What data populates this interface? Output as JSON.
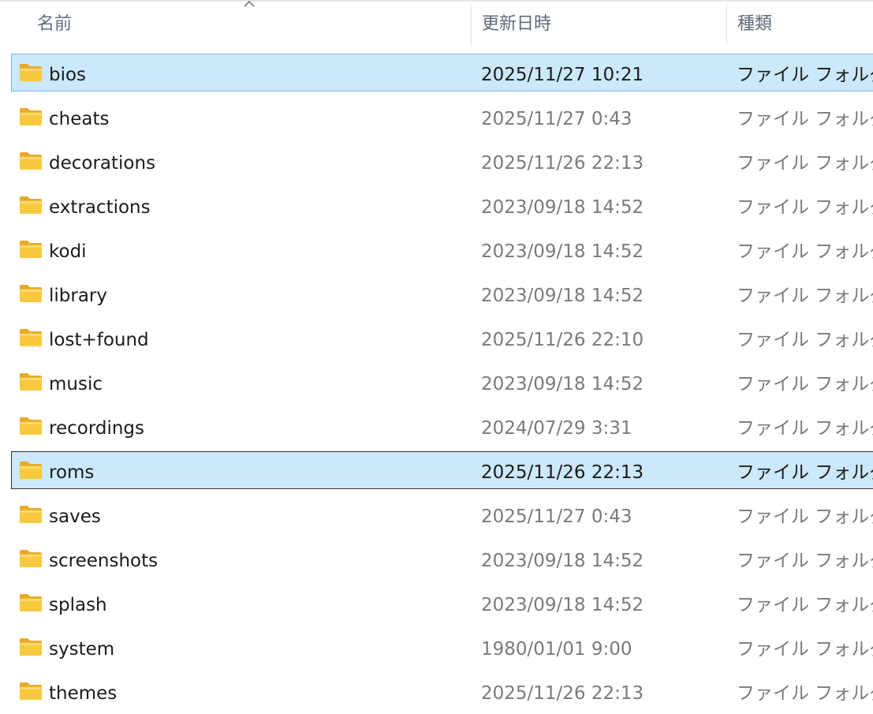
{
  "header": {
    "name_label": "名前",
    "date_label": "更新日時",
    "type_label": "種類",
    "sort_icon": "chevron-up-icon"
  },
  "colors": {
    "selection_bg": "#cce8fb",
    "selection_border": "#7ab4dc",
    "focus_border": "#2f2f2f",
    "folder_yellow": "#f8c93f"
  },
  "rows": [
    {
      "name": "bios",
      "date": "2025/11/27 10:21",
      "type": "ファイル フォルダー",
      "selected": true
    },
    {
      "name": "cheats",
      "date": "2025/11/27 0:43",
      "type": "ファイル フォルダー",
      "selected": false
    },
    {
      "name": "decorations",
      "date": "2025/11/26 22:13",
      "type": "ファイル フォルダー",
      "selected": false
    },
    {
      "name": "extractions",
      "date": "2023/09/18 14:52",
      "type": "ファイル フォルダー",
      "selected": false
    },
    {
      "name": "kodi",
      "date": "2023/09/18 14:52",
      "type": "ファイル フォルダー",
      "selected": false
    },
    {
      "name": "library",
      "date": "2023/09/18 14:52",
      "type": "ファイル フォルダー",
      "selected": false
    },
    {
      "name": "lost+found",
      "date": "2025/11/26 22:10",
      "type": "ファイル フォルダー",
      "selected": false
    },
    {
      "name": "music",
      "date": "2023/09/18 14:52",
      "type": "ファイル フォルダー",
      "selected": false
    },
    {
      "name": "recordings",
      "date": "2024/07/29 3:31",
      "type": "ファイル フォルダー",
      "selected": false
    },
    {
      "name": "roms",
      "date": "2025/11/26 22:13",
      "type": "ファイル フォルダー",
      "selected": true,
      "focused": true
    },
    {
      "name": "saves",
      "date": "2025/11/27 0:43",
      "type": "ファイル フォルダー",
      "selected": false
    },
    {
      "name": "screenshots",
      "date": "2023/09/18 14:52",
      "type": "ファイル フォルダー",
      "selected": false
    },
    {
      "name": "splash",
      "date": "2023/09/18 14:52",
      "type": "ファイル フォルダー",
      "selected": false
    },
    {
      "name": "system",
      "date": "1980/01/01 9:00",
      "type": "ファイル フォルダー",
      "selected": false
    },
    {
      "name": "themes",
      "date": "2025/11/26 22:13",
      "type": "ファイル フォルダー",
      "selected": false
    }
  ]
}
